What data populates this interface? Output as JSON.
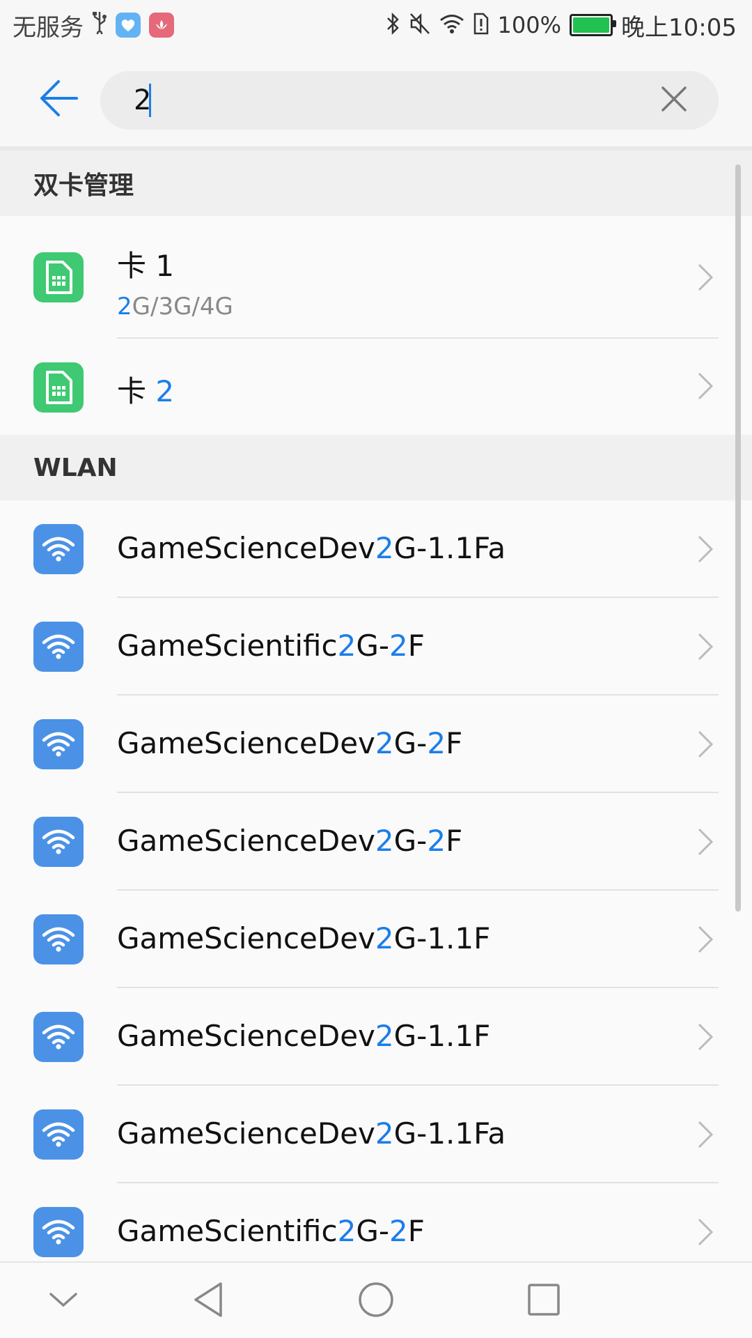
{
  "status_bar": {
    "carrier": "无服务",
    "battery_percent": "100%",
    "battery_level": 1.0,
    "time": "晚上10:05"
  },
  "search": {
    "query": "2",
    "back_icon": "back-arrow-icon",
    "clear_icon": "close-icon"
  },
  "sections": {
    "dual_sim": {
      "header": "双卡管理",
      "items": [
        {
          "title_pre": "卡 1",
          "title_hl": "",
          "title_post": "",
          "sub_hl": "2",
          "sub_rest": "G/3G/4G"
        },
        {
          "title_pre": "卡 ",
          "title_hl": "2",
          "title_post": ""
        }
      ]
    },
    "wlan": {
      "header": "WLAN",
      "items": [
        {
          "pre": "GameScienceDev",
          "hl1": "2",
          "mid": "G-1.1Fa",
          "hl2": "",
          "post": ""
        },
        {
          "pre": "GameScientific",
          "hl1": "2",
          "mid": "G-",
          "hl2": "2",
          "post": "F"
        },
        {
          "pre": "GameScienceDev",
          "hl1": "2",
          "mid": "G-",
          "hl2": "2",
          "post": "F"
        },
        {
          "pre": "GameScienceDev",
          "hl1": "2",
          "mid": "G-",
          "hl2": "2",
          "post": "F"
        },
        {
          "pre": "GameScienceDev",
          "hl1": "2",
          "mid": "G-1.1F",
          "hl2": "",
          "post": ""
        },
        {
          "pre": "GameScienceDev",
          "hl1": "2",
          "mid": "G-1.1F",
          "hl2": "",
          "post": ""
        },
        {
          "pre": "GameScienceDev",
          "hl1": "2",
          "mid": "G-1.1Fa",
          "hl2": "",
          "post": ""
        },
        {
          "pre": "GameScientific",
          "hl1": "2",
          "mid": "G-",
          "hl2": "2",
          "post": "F"
        }
      ]
    }
  },
  "colors": {
    "accent": "#1b7ee9",
    "sim_icon": "#3ec972",
    "wifi_icon": "#4b92e6"
  }
}
